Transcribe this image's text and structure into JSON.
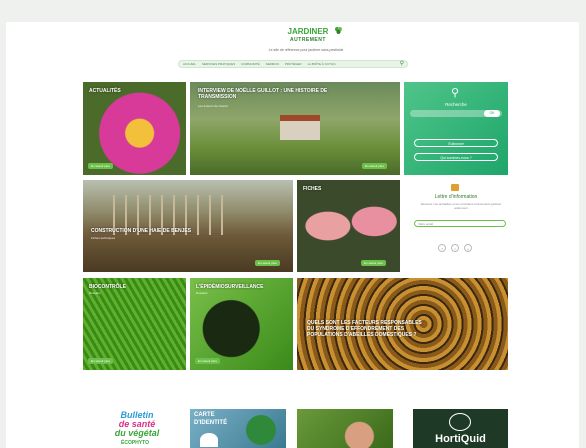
{
  "site": {
    "logo_main": "JARDINER",
    "logo_sub": "AUTREMENT",
    "tagline": "Le site de référence pour jardiner sans pesticide"
  },
  "nav": {
    "items": [
      "ACCUEIL",
      "SERVICES PRATIQUES",
      "COMMUNITÉ",
      "SERMON",
      "PROTÉGER",
      "LA BOÎTE À OUTILS"
    ]
  },
  "tiles": {
    "flower": {
      "title": "ACTUALITÉS",
      "button": "En savoir plus"
    },
    "interview": {
      "title": "INTERVIEW DE NOËLLE GUILLOT : UNE HISTOIRE DE TRANSMISSION",
      "sub": "Les acteurs de l'avenir",
      "button": "En savoir plus"
    },
    "haie": {
      "title": "CONSTRUCTION D'UNE HAIE DE BENJES",
      "sub": "Fiches techniques",
      "button": "En savoir plus"
    },
    "tulips": {
      "title": "FICHES",
      "button": "En savoir plus"
    },
    "biocontrole": {
      "title": "BIOCONTRÔLE",
      "sub": "Dossiers",
      "button": "En savoir plus"
    },
    "epidemio": {
      "title": "L'ÉPIDÉMIOSURVEILLANCE",
      "sub": "Dossiers",
      "button": "En savoir plus"
    },
    "abeilles": {
      "title": "QUELS SONT LES FACTEURS RESPONSABLES DU SYNDROME D'EFFONDREMENT DES POPULATIONS D'ABEILLES DOMESTIQUES ?"
    }
  },
  "search_box": {
    "label": "Recherche",
    "ok": "OK",
    "subscribe": "S'abonner",
    "who": "Qui sommes-nous ?"
  },
  "newsletter": {
    "title": "Lettre d'information",
    "desc": "Recevez nos actualités et les prochains événements jardiner autrement",
    "email_placeholder": "Votre email",
    "socials": [
      "f",
      "t",
      "y"
    ]
  },
  "bottom": {
    "bulletin_line1": "Bulletin",
    "bulletin_line2": "de santé",
    "bulletin_line3": "du végétal",
    "ecophyto": "ÉCOPHYTO",
    "carte": "CARTE",
    "identite": "D'IDENTITÉ",
    "horti": "HortiQuid"
  },
  "colors": {
    "accent": "#6cc04a",
    "search_box": "#1ea56a",
    "logo": "#3aa53a"
  }
}
